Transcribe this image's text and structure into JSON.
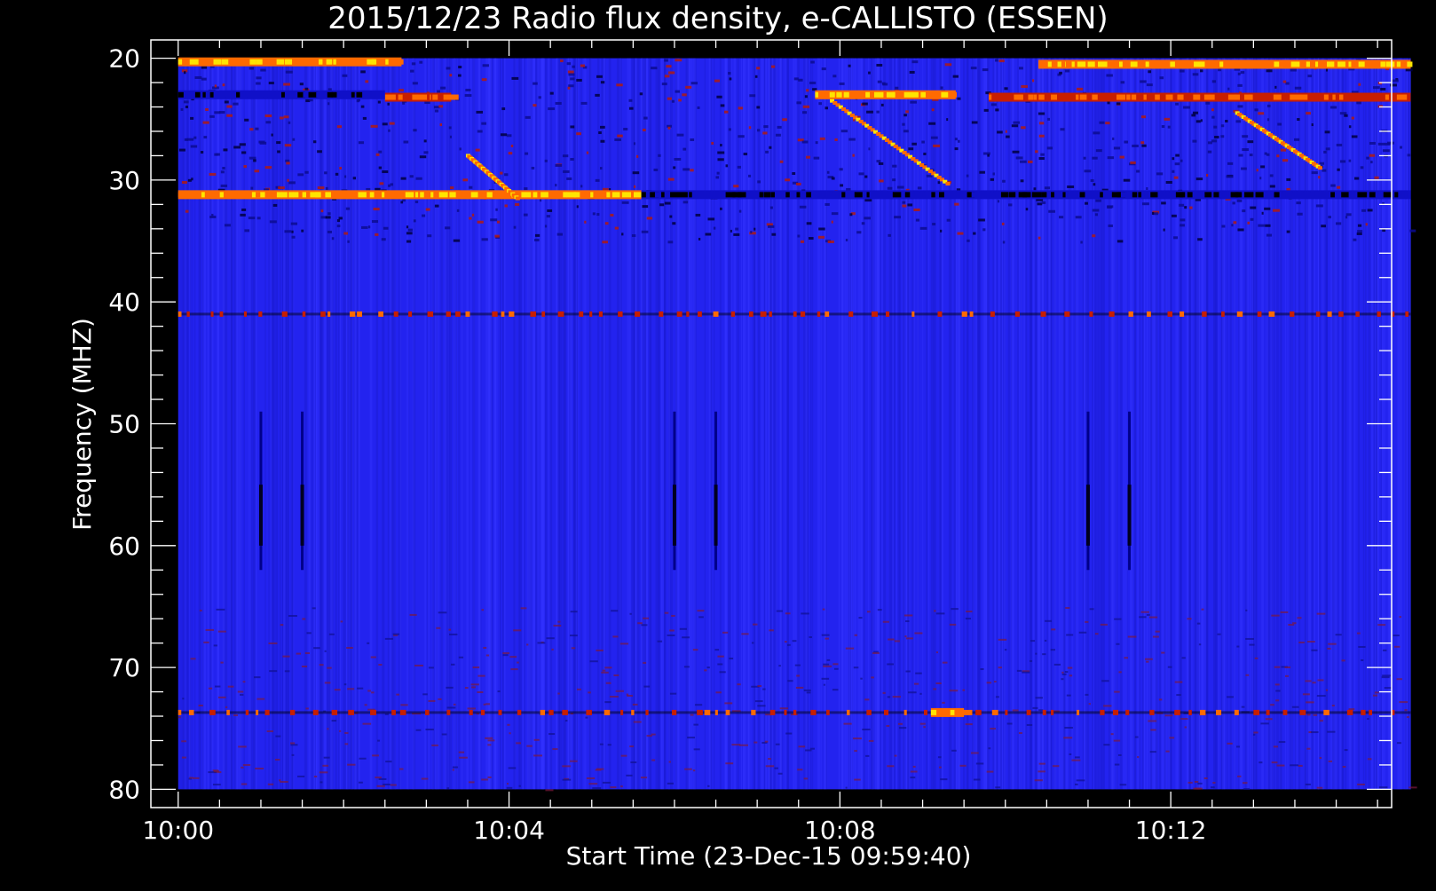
{
  "chart_data": {
    "type": "heatmap",
    "title": "2015/12/23  Radio flux density, e-CALLISTO (ESSEN)",
    "xlabel": "Start Time (23-Dec-15 09:59:40)",
    "ylabel": "Frequency (MHZ)",
    "x_start_label": "09:59:40",
    "xlim_minutes_after_1000": [
      -0.33,
      14.67
    ],
    "data_extent_minutes_after_1000": [
      0.0,
      14.9
    ],
    "ylim": [
      18.5,
      81.5
    ],
    "y_inverted": true,
    "x_ticks": [
      {
        "value": 0,
        "label": "10:00"
      },
      {
        "value": 4,
        "label": "10:04"
      },
      {
        "value": 8,
        "label": "10:08"
      },
      {
        "value": 12,
        "label": "10:12"
      }
    ],
    "y_ticks": [
      {
        "value": 20,
        "label": "20"
      },
      {
        "value": 30,
        "label": "30"
      },
      {
        "value": 40,
        "label": "40"
      },
      {
        "value": 50,
        "label": "50"
      },
      {
        "value": 60,
        "label": "60"
      },
      {
        "value": 70,
        "label": "70"
      },
      {
        "value": 80,
        "label": "80"
      }
    ],
    "colormap": [
      "#000000",
      "#1010c8",
      "#2a2aff",
      "#c81e00",
      "#ff6a00",
      "#ffe400",
      "#ffffff"
    ],
    "background_color": "#2323ef",
    "features": [
      {
        "kind": "band",
        "f": 20.3,
        "t0": 0.0,
        "t1": 2.7,
        "level": "high"
      },
      {
        "kind": "band",
        "f": 20.5,
        "t0": 10.4,
        "t1": 14.9,
        "level": "high"
      },
      {
        "kind": "band",
        "f": 23.0,
        "t0": 7.7,
        "t1": 9.4,
        "level": "high"
      },
      {
        "kind": "band",
        "f": 23.2,
        "t0": 2.5,
        "t1": 3.3,
        "level": "medium"
      },
      {
        "kind": "band",
        "f": 23.2,
        "t0": 9.8,
        "t1": 14.9,
        "level": "medium"
      },
      {
        "kind": "band",
        "f": 23.0,
        "t0": 0.0,
        "t1": 2.5,
        "level": "low"
      },
      {
        "kind": "band",
        "f": 31.2,
        "t0": 0.0,
        "t1": 5.6,
        "level": "high"
      },
      {
        "kind": "band",
        "f": 31.2,
        "t0": 5.6,
        "t1": 14.9,
        "level": "low"
      },
      {
        "kind": "band",
        "f": 41.0,
        "t0": 0.0,
        "t1": 14.9,
        "level": "dots"
      },
      {
        "kind": "band",
        "f": 73.7,
        "t0": 0.0,
        "t1": 14.9,
        "level": "dots"
      },
      {
        "kind": "band",
        "f": 73.7,
        "t0": 9.1,
        "t1": 9.5,
        "level": "high"
      },
      {
        "kind": "sweep",
        "t0": 3.5,
        "f0": 28.0,
        "t1": 4.1,
        "f1": 31.5
      },
      {
        "kind": "sweep",
        "t0": 7.9,
        "f0": 23.5,
        "t1": 9.3,
        "f1": 30.3
      },
      {
        "kind": "sweep",
        "t0": 12.8,
        "f0": 24.5,
        "t1": 13.8,
        "f1": 29.0
      },
      {
        "kind": "spike",
        "t": 1.0,
        "f0": 49.0,
        "f1": 62.0
      },
      {
        "kind": "spike",
        "t": 1.5,
        "f0": 49.0,
        "f1": 62.0
      },
      {
        "kind": "spike",
        "t": 6.0,
        "f0": 49.0,
        "f1": 62.0
      },
      {
        "kind": "spike",
        "t": 6.5,
        "f0": 49.0,
        "f1": 62.0
      },
      {
        "kind": "spike",
        "t": 11.0,
        "f0": 49.0,
        "f1": 62.0
      },
      {
        "kind": "spike",
        "t": 11.5,
        "f0": 49.0,
        "f1": 62.0
      }
    ]
  }
}
